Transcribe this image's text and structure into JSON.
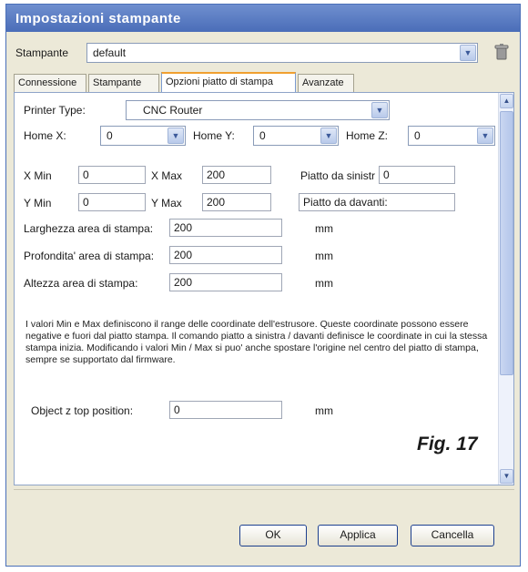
{
  "window": {
    "title": "Impostazioni stampante"
  },
  "printer": {
    "label": "Stampante",
    "value": "default"
  },
  "tabs": [
    {
      "label": "Connessione"
    },
    {
      "label": "Stampante"
    },
    {
      "label": "Opzioni piatto di stampa"
    },
    {
      "label": "Avanzate"
    }
  ],
  "panel": {
    "printer_type": {
      "label": "Printer Type:",
      "value": "CNC Router"
    },
    "home_x": {
      "label": "Home X:",
      "value": "0"
    },
    "home_y": {
      "label": "Home Y:",
      "value": "0"
    },
    "home_z": {
      "label": "Home Z:",
      "value": "0"
    },
    "x_min": {
      "label": "X Min",
      "value": "0"
    },
    "x_max": {
      "label": "X Max",
      "value": "200"
    },
    "piatto_sinistra": {
      "label": "Piatto da sinistr",
      "value": "0"
    },
    "y_min": {
      "label": "Y Min",
      "value": "0"
    },
    "y_max": {
      "label": "Y Max",
      "value": "200"
    },
    "piatto_davanti": {
      "label": "Piatto da davanti:",
      "value": ""
    },
    "larghezza": {
      "label": "Larghezza area di stampa:",
      "value": "200",
      "unit": "mm"
    },
    "profondita": {
      "label": "Profondita' area di stampa:",
      "value": "200",
      "unit": "mm"
    },
    "altezza": {
      "label": "Altezza area di stampa:",
      "value": "200",
      "unit": "mm"
    },
    "info": "I valori Min e Max definiscono il range delle coordinate dell'estrusore. Queste coordinate possono essere negative e fuori dal piatto stampa. Il comando piatto a sinistra / davanti definisce le coordinate in cui la stessa stampa inizia. Modificando i valori Min / Max si puo' anche spostare l'origine nel centro del piatto di stampa, sempre se supportato dal firmware.",
    "object_z": {
      "label": "Object z top position:",
      "value": "0",
      "unit": "mm"
    }
  },
  "caption": "Fig. 17",
  "buttons": {
    "ok": "OK",
    "apply": "Applica",
    "cancel": "Cancella"
  }
}
